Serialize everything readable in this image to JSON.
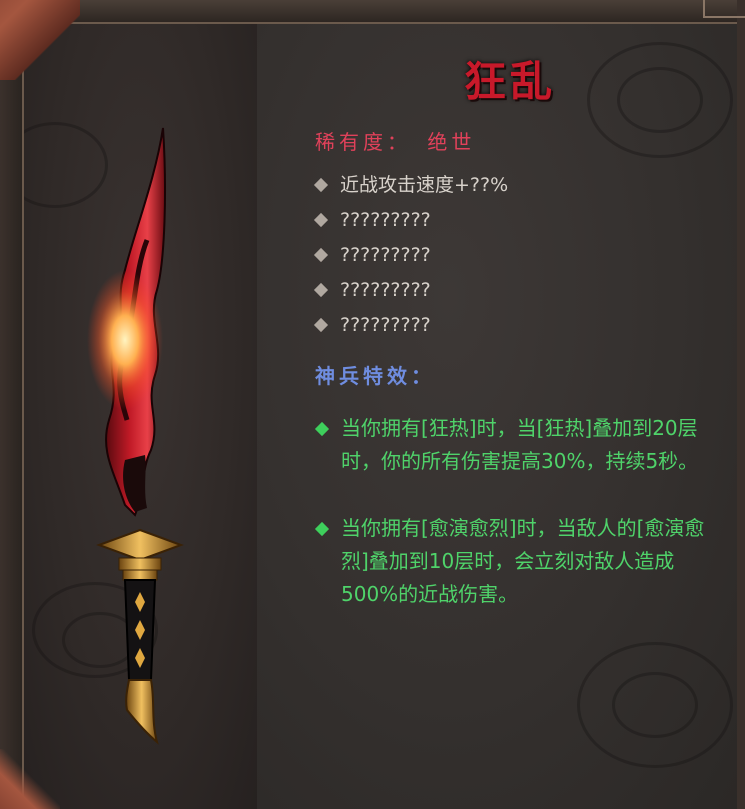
{
  "item": {
    "name": "狂乱",
    "rarity_label": "稀有度：",
    "rarity_value": "绝世",
    "stats": [
      "近战攻击速度+??%",
      "?????????",
      "?????????",
      "?????????",
      "?????????"
    ],
    "special_heading": "神兵特效：",
    "special_effects": [
      "当你拥有[狂热]时，当[狂热]叠加到20层时，你的所有伤害提高30%，持续5秒。",
      "当你拥有[愈演愈烈]时，当敌人的[愈演愈烈]叠加到10层时，会立刻对敌人造成500%的近战伤害。"
    ]
  },
  "colors": {
    "title": "#c8192a",
    "rarity": "#e0415a",
    "stat": "#d8d2cb",
    "special_heading": "#6f8de0",
    "special_effect": "#4fd36a"
  },
  "icons": {
    "stat_bullet": "diamond-icon",
    "effect_bullet": "green-diamond-icon",
    "weapon": "red-blade-weapon-icon"
  }
}
